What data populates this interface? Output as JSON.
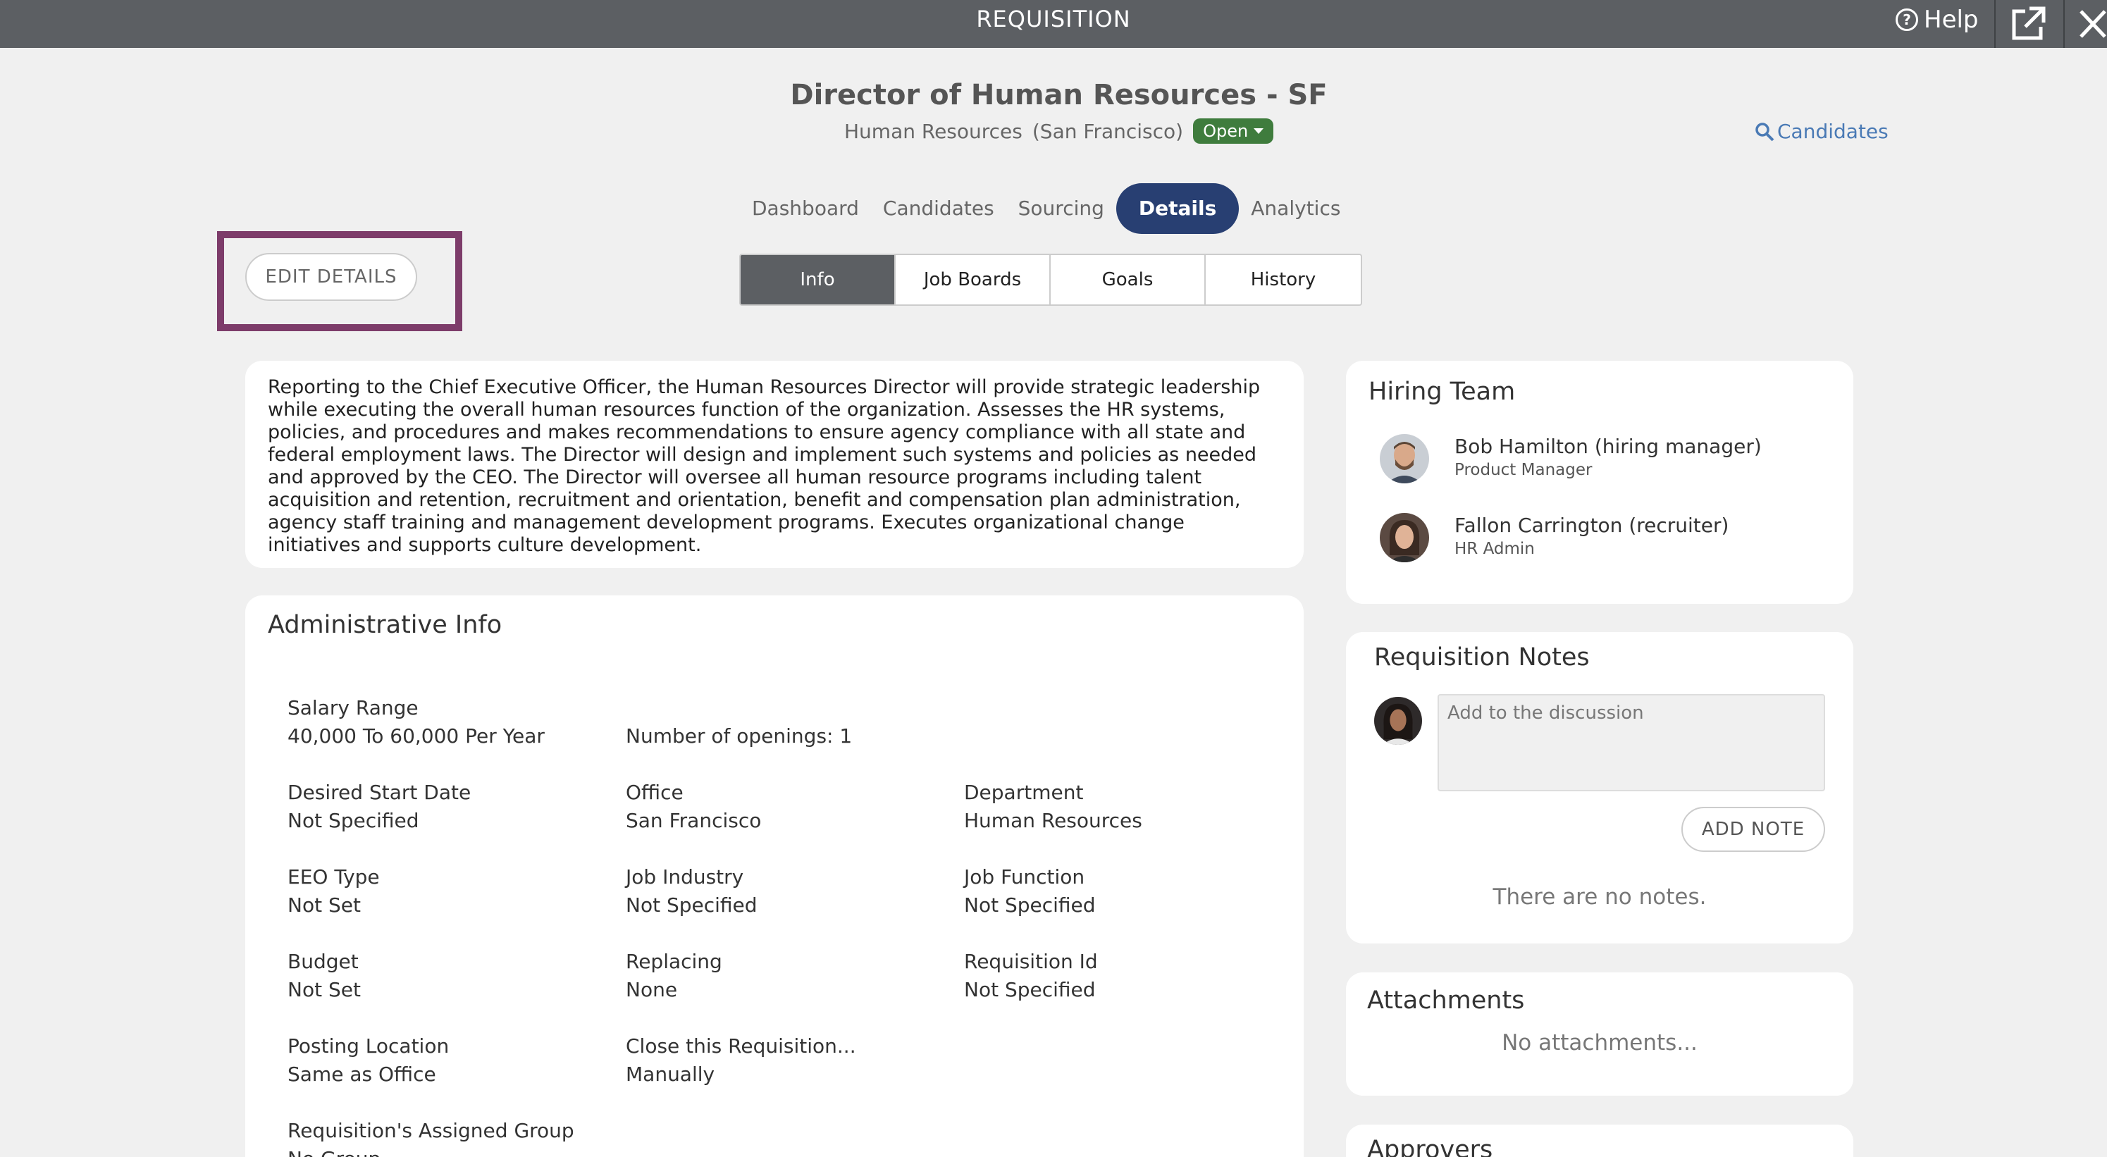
{
  "topbar": {
    "title": "REQUISITION",
    "help_label": "Help",
    "help_glyph": "?"
  },
  "requisition": {
    "title": "Director of Human Resources - SF",
    "department": "Human Resources",
    "location": "(San Francisco)",
    "status": "Open"
  },
  "candidates_link": "Candidates",
  "main_tabs": [
    "Dashboard",
    "Candidates",
    "Sourcing",
    "Details",
    "Analytics"
  ],
  "sub_tabs": [
    "Info",
    "Job Boards",
    "Goals",
    "History"
  ],
  "edit_button": "EDIT DETAILS",
  "description": "Reporting to the Chief Executive Officer, the Human Resources Director will provide strategic leadership while executing the overall human resources function of the organization. Assesses the HR systems, policies, and procedures and makes recommendations to ensure agency compliance with all state and federal employment laws. The Director will design and implement such systems and policies as needed and approved by the CEO. The Director will oversee all human resource programs including talent acquisition and retention, recruitment and orientation, benefit and compensation plan administration, agency staff training and management development programs. Executes organizational change initiatives and supports culture development.",
  "admin": {
    "heading": "Administrative Info",
    "salary_label": "Salary Range",
    "salary_value": "40,000 To 60,000 Per Year",
    "openings": "Number of openings: 1",
    "start_label": "Desired Start Date",
    "start_value": "Not Specified",
    "office_label": "Office",
    "office_value": "San Francisco",
    "dept_label": "Department",
    "dept_value": "Human Resources",
    "eeo_label": "EEO Type",
    "eeo_value": "Not Set",
    "industry_label": "Job Industry",
    "industry_value": "Not Specified",
    "function_label": "Job Function",
    "function_value": "Not Specified",
    "budget_label": "Budget",
    "budget_value": "Not Set",
    "replacing_label": "Replacing",
    "replacing_value": "None",
    "reqid_label": "Requisition Id",
    "reqid_value": "Not Specified",
    "posting_label": "Posting Location",
    "posting_value": "Same as Office",
    "close_label": "Close this Requisition...",
    "close_value": "Manually",
    "group_label": "Requisition's Assigned Group",
    "group_value": "No Group"
  },
  "hiring_team": {
    "heading": "Hiring Team",
    "members": [
      {
        "name": "Bob Hamilton (hiring manager)",
        "role": "Product Manager"
      },
      {
        "name": "Fallon Carrington (recruiter)",
        "role": "HR Admin"
      }
    ]
  },
  "notes": {
    "heading": "Requisition Notes",
    "placeholder": "Add to the discussion",
    "add_button": "ADD NOTE",
    "empty": "There are no notes."
  },
  "attachments": {
    "heading": "Attachments",
    "empty": "No attachments..."
  },
  "approvers": {
    "heading": "Approvers"
  },
  "colors": {
    "topbar": "#5c5f63",
    "active_tab": "#283f72",
    "status_green": "#3f7c3d",
    "highlight": "#7d3c6a",
    "link": "#4a7ab5"
  }
}
